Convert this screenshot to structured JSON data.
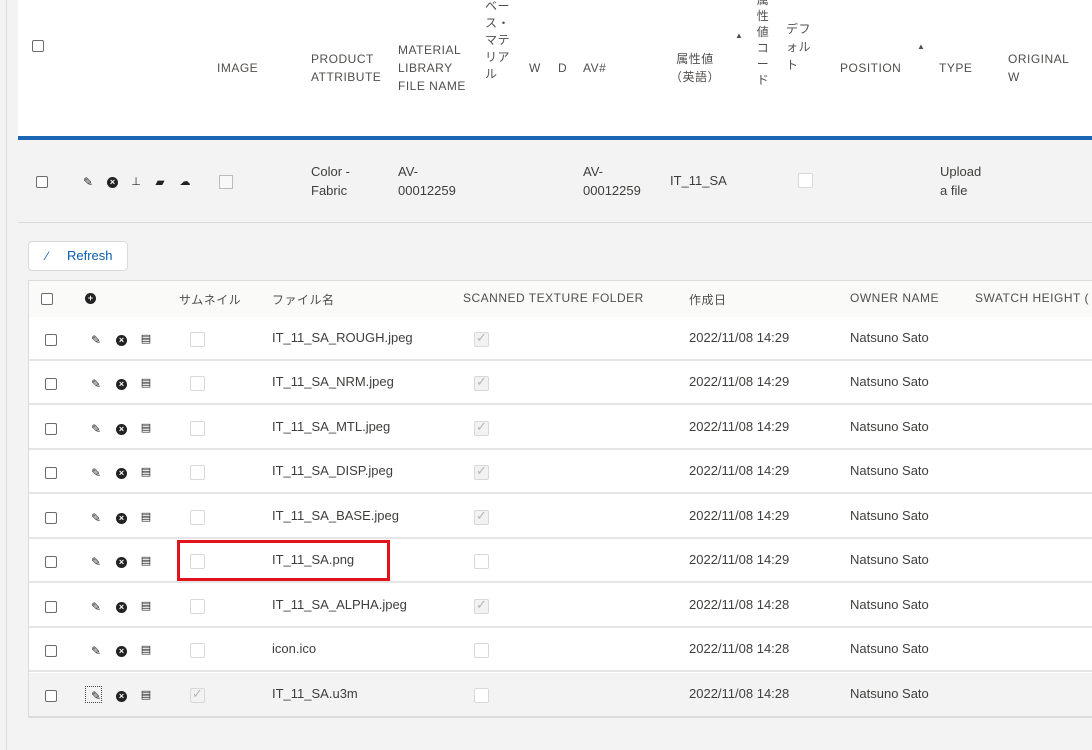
{
  "header": {
    "columns": {
      "image": "IMAGE",
      "product_attribute": [
        "PRODUCT",
        "ATTRIBUTE"
      ],
      "material_file": [
        "MATERIAL",
        "LIBRARY",
        "FILE NAME"
      ],
      "base_material": [
        "ベー",
        "ス・",
        "マテ",
        "リア",
        "ル"
      ],
      "w": "W",
      "d": "D",
      "av": "AV#",
      "attr_value_en": [
        "属性値",
        "（英語）"
      ],
      "attr_value_code": [
        "属",
        "性",
        "値",
        "コ",
        "ー",
        "ド"
      ],
      "default": [
        "デフ",
        "ォル",
        "ト"
      ],
      "position": "POSITION",
      "type": "TYPE",
      "original": [
        "ORIGINAL",
        "W"
      ]
    }
  },
  "record": {
    "product_attribute": [
      "Color -",
      "Fabric"
    ],
    "material_file": [
      "AV-",
      "00012259"
    ],
    "av": [
      "AV-",
      "00012259"
    ],
    "attr_value_en": "IT_11_SA",
    "type": [
      "Upload",
      "a file"
    ]
  },
  "refresh_label": "Refresh",
  "files": {
    "columns": {
      "thumbnail": "サムネイル",
      "filename": "ファイル名",
      "scanned": "SCANNED TEXTURE FOLDER",
      "created": "作成日",
      "owner": "OWNER NAME",
      "swatch": "SWATCH HEIGHT ("
    },
    "rows": [
      {
        "filename": "IT_11_SA_ROUGH.jpeg",
        "created": "2022/11/08 14:29",
        "owner": "Natsuno Sato"
      },
      {
        "filename": "IT_11_SA_NRM.jpeg",
        "created": "2022/11/08 14:29",
        "owner": "Natsuno Sato"
      },
      {
        "filename": "IT_11_SA_MTL.jpeg",
        "created": "2022/11/08 14:29",
        "owner": "Natsuno Sato"
      },
      {
        "filename": "IT_11_SA_DISP.jpeg",
        "created": "2022/11/08 14:29",
        "owner": "Natsuno Sato"
      },
      {
        "filename": "IT_11_SA_BASE.jpeg",
        "created": "2022/11/08 14:29",
        "owner": "Natsuno Sato"
      },
      {
        "filename": "IT_11_SA.png",
        "created": "2022/11/08 14:29",
        "owner": "Natsuno Sato"
      },
      {
        "filename": "IT_11_SA_ALPHA.jpeg",
        "created": "2022/11/08 14:28",
        "owner": "Natsuno Sato"
      },
      {
        "filename": "icon.ico",
        "created": "2022/11/08 14:28",
        "owner": "Natsuno Sato"
      },
      {
        "filename": "IT_11_SA.u3m",
        "created": "2022/11/08 14:28",
        "owner": "Natsuno Sato"
      }
    ]
  }
}
